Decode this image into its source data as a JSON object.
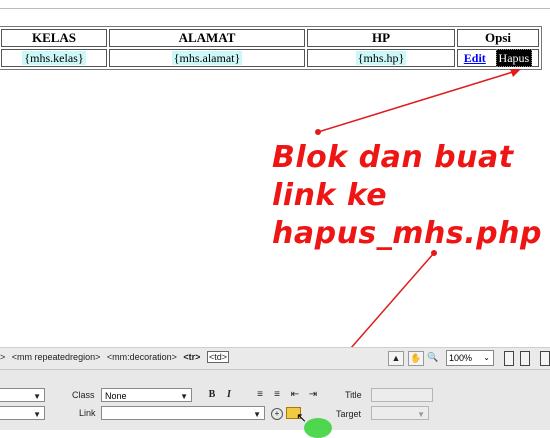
{
  "table": {
    "headers": [
      "KELAS",
      "ALAMAT",
      "HP",
      "Opsi"
    ],
    "row": {
      "kelas": "{mhs.kelas}",
      "alamat": "{mhs.alamat}",
      "hp": "{mhs.hp}",
      "edit": "Edit",
      "hapus": "Hapus"
    }
  },
  "annotation": {
    "line1": "Blok dan buat",
    "line2": "link ke",
    "line3": "hapus_mhs.php",
    "color": "#ee1515"
  },
  "statusbar": {
    "crumbs": [
      ">",
      "<mm repeatedregion>",
      "<mm:decoration>",
      "<tr>",
      "<td>"
    ],
    "zoom": "100%"
  },
  "inspector": {
    "class_label": "Class",
    "class_value": "None",
    "link_label": "Link",
    "link_value": "",
    "bold": "B",
    "italic": "I",
    "title_label": "Title",
    "target_label": "Target"
  },
  "icons": [
    "pointer-icon",
    "hand-icon",
    "zoom-icon",
    "point-to-file-icon",
    "browse-folder-icon",
    "list-icons"
  ]
}
